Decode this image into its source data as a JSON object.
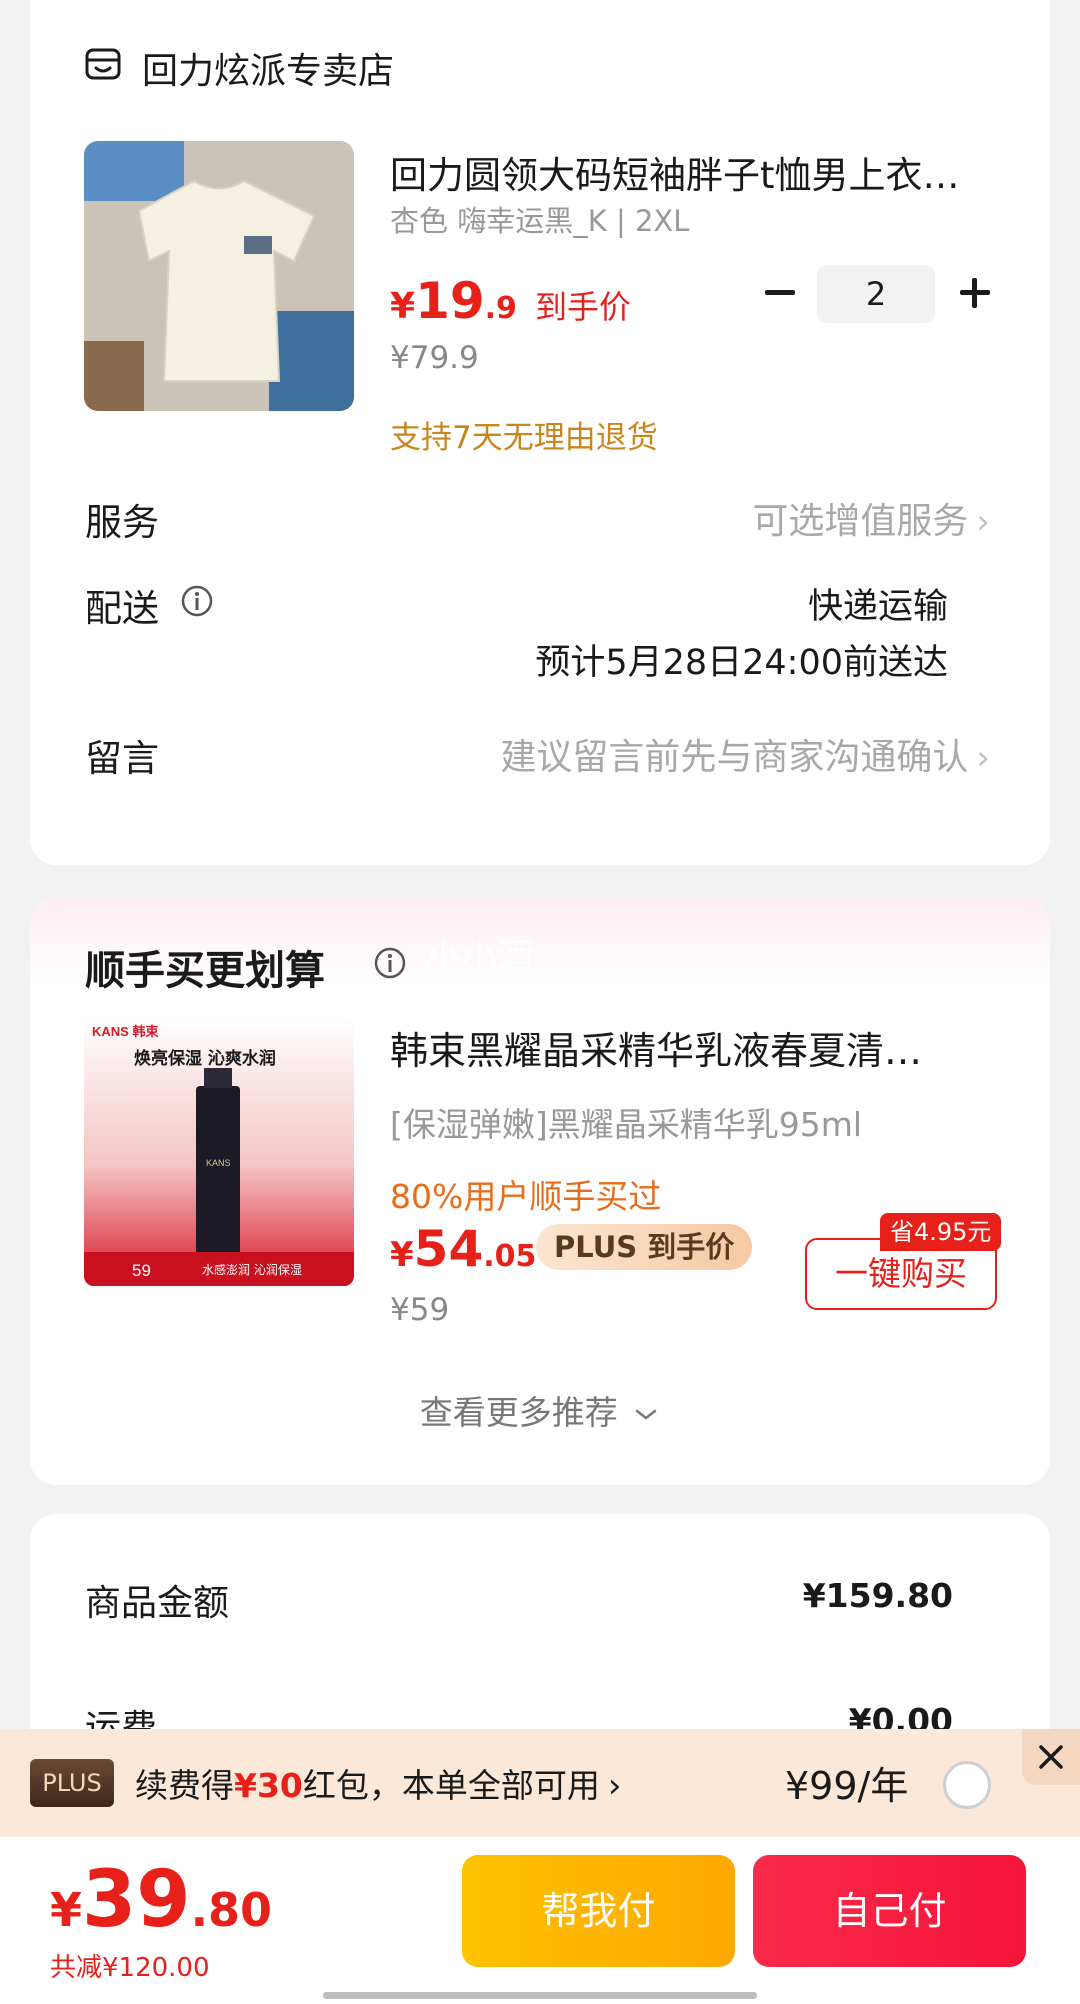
{
  "store": {
    "name": "回力炫派专卖店",
    "icon": "store-icon"
  },
  "product": {
    "title": "回力圆领大码短袖胖子t恤男上衣…",
    "spec": "杏色 嗨幸运黑_K | 2XL",
    "price_symbol": "¥",
    "price_int": "19",
    "price_dec": ".9",
    "price_label": "到手价",
    "original_price": "¥79.9",
    "return_policy": "支持7天无理由退货",
    "quantity": "2"
  },
  "service": {
    "label": "服务",
    "value": "可选增值服务"
  },
  "delivery": {
    "label": "配送",
    "method": "快递运输",
    "eta": "预计5月28日24:00前送达"
  },
  "message": {
    "label": "留言",
    "placeholder": "建议留言前先与商家沟通确认"
  },
  "recommend": {
    "title": "顺手买更划算",
    "watermark": "小小酒",
    "item": {
      "title": "韩束黑耀晶采精华乳液春夏清…",
      "spec": "[保湿弹嫩]黑耀晶采精华乳95ml",
      "users_text": "80%用户顺手买过",
      "price_symbol": "¥",
      "price_int": "54",
      "price_dec": ".05",
      "plus_label": "PLUS 到手价",
      "original_price": "¥59",
      "save_tag": "省4.95元",
      "buy_label": "一键购买",
      "image_brand": "KANS 韩束",
      "image_slogan": "焕亮保湿 沁爽水润",
      "image_bottom_price": "59",
      "image_bottom_text": "水感澎润 沁润保湿",
      "image_bottle_text": "KANS"
    },
    "more_label": "查看更多推荐"
  },
  "summary": [
    {
      "label": "商品金额",
      "value": "¥159.80"
    },
    {
      "label": "运费",
      "value": "¥0.00"
    }
  ],
  "plus_banner": {
    "logo": "PLUS",
    "text_prefix": "续费得",
    "text_highlight": "¥30",
    "text_suffix": "红包，本单全部可用",
    "price": "¥99/年"
  },
  "checkout": {
    "total_symbol": "¥",
    "total_int": "39",
    "total_dec": ".80",
    "discount": "共减¥120.00",
    "help_pay": "帮我付",
    "self_pay": "自己付"
  },
  "colors": {
    "accent_red": "#e8201a",
    "orange": "#c9861d",
    "yellow_button": "#fdc200",
    "red_button": "#f5143a"
  }
}
